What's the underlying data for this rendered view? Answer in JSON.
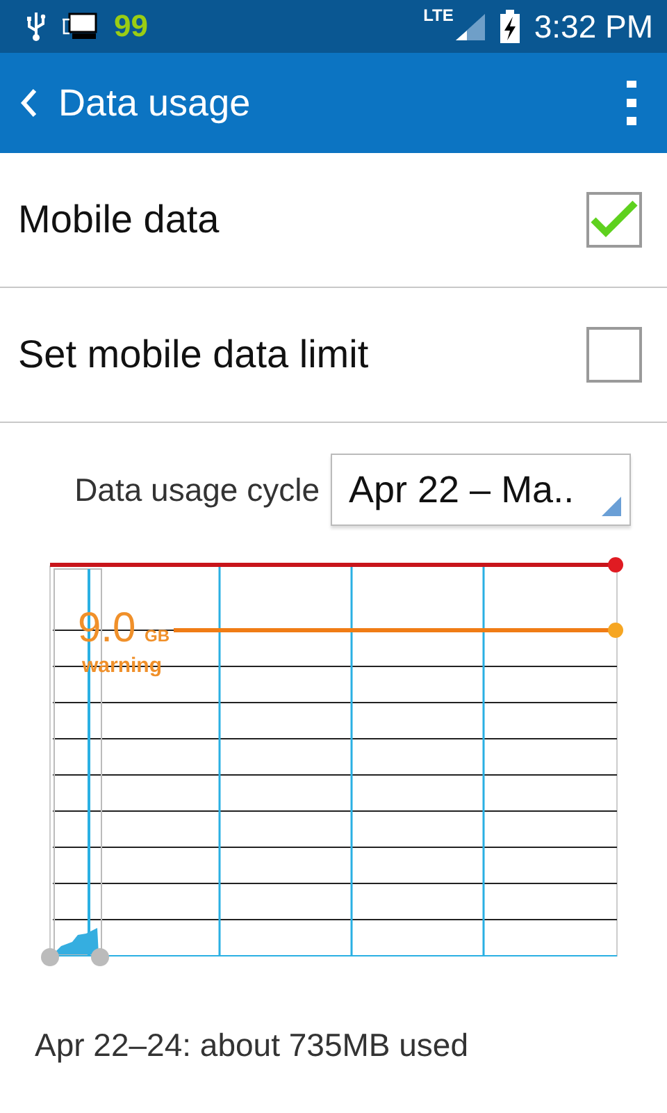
{
  "status_bar": {
    "notification_count": "99",
    "network": "LTE",
    "time": "3:32 PM"
  },
  "app_bar": {
    "title": "Data usage"
  },
  "settings": [
    {
      "kind": "checkbox",
      "label": "Mobile data",
      "checked": true
    },
    {
      "kind": "checkbox",
      "label": "Set mobile data limit",
      "checked": false
    }
  ],
  "cycle": {
    "label": "Data usage cycle",
    "value": "Apr 22 – Ma.."
  },
  "chart": {
    "warning_value": "9.0",
    "warning_unit": "GB",
    "warning_label": "warning"
  },
  "summary": "Apr 22–24: about 735MB used"
}
